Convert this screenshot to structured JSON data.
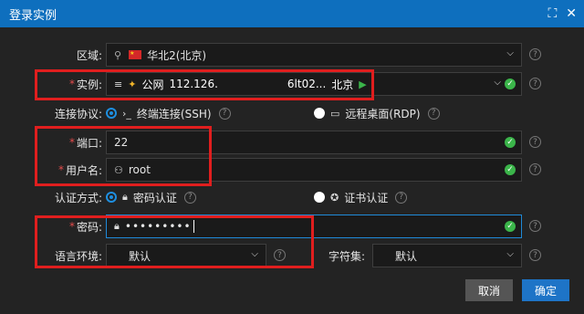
{
  "window": {
    "title": "登录实例",
    "maximize_icon": "expand-icon",
    "close_icon": "close-icon"
  },
  "fields": {
    "region": {
      "label": "区域:",
      "value": "华北2(北京)"
    },
    "instance": {
      "label": "实例:",
      "network": "公网",
      "ip": "112.126.",
      "name": "6lt02...",
      "location": "北京"
    },
    "protocol": {
      "label": "连接协议:",
      "options": [
        {
          "label": "终端连接(SSH)",
          "selected": true
        },
        {
          "label": "远程桌面(RDP)",
          "selected": false
        }
      ]
    },
    "port": {
      "label": "端口:",
      "value": "22"
    },
    "username": {
      "label": "用户名:",
      "value": "root"
    },
    "auth": {
      "label": "认证方式:",
      "options": [
        {
          "label": "密码认证",
          "selected": true
        },
        {
          "label": "证书认证",
          "selected": false
        }
      ]
    },
    "password": {
      "label": "密码:",
      "value": "•••••••••"
    },
    "locale": {
      "label": "语言环境:",
      "value": "默认"
    },
    "charset": {
      "label": "字符集:",
      "value": "默认"
    }
  },
  "buttons": {
    "cancel": "取消",
    "confirm": "确定"
  },
  "colors": {
    "accent": "#0e6fbe",
    "highlight": "#e01e1e",
    "success": "#3bb54a"
  }
}
